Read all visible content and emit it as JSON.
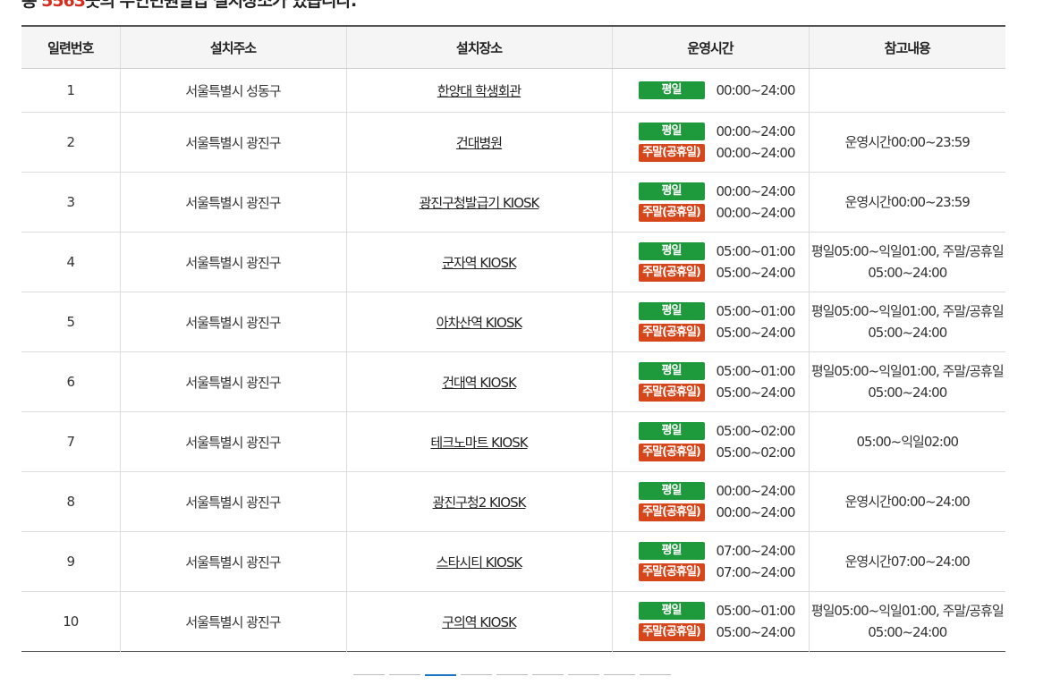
{
  "summary": {
    "prefix": "총 ",
    "count": "5563",
    "suffix": "곳의 무인민원발급 설치장소가 있습니다."
  },
  "columns": {
    "no": "일련번호",
    "address": "설치주소",
    "place": "설치장소",
    "hours": "운영시간",
    "note": "참고내용"
  },
  "labels": {
    "weekday": "평일",
    "weekend": "주말(공휴일)"
  },
  "colors": {
    "weekday_badge": "#1e9a3c",
    "weekend_badge": "#d6461a",
    "highlight_count": "#d62d20",
    "active_page": "#1a73c8"
  },
  "rows": [
    {
      "no": "1",
      "address": "서울특별시 성동구",
      "place": "한양대 학생회관",
      "weekday": "00:00~24:00",
      "weekend": "",
      "note": ""
    },
    {
      "no": "2",
      "address": "서울특별시 광진구",
      "place": "건대병원",
      "weekday": "00:00~24:00",
      "weekend": "00:00~24:00",
      "note": "운영시간00:00~23:59"
    },
    {
      "no": "3",
      "address": "서울특별시 광진구",
      "place": "광진구청발급기 KIOSK",
      "weekday": "00:00~24:00",
      "weekend": "00:00~24:00",
      "note": "운영시간00:00~23:59"
    },
    {
      "no": "4",
      "address": "서울특별시 광진구",
      "place": "군자역 KIOSK",
      "weekday": "05:00~01:00",
      "weekend": "05:00~24:00",
      "note": "평일05:00~익일01:00, 주말/공휴일 05:00~24:00"
    },
    {
      "no": "5",
      "address": "서울특별시 광진구",
      "place": "아차산역 KIOSK",
      "weekday": "05:00~01:00",
      "weekend": "05:00~24:00",
      "note": "평일05:00~익일01:00, 주말/공휴일 05:00~24:00"
    },
    {
      "no": "6",
      "address": "서울특별시 광진구",
      "place": "건대역 KIOSK",
      "weekday": "05:00~01:00",
      "weekend": "05:00~24:00",
      "note": "평일05:00~익일01:00, 주말/공휴일 05:00~24:00"
    },
    {
      "no": "7",
      "address": "서울특별시 광진구",
      "place": "테크노마트 KIOSK",
      "weekday": "05:00~02:00",
      "weekend": "05:00~02:00",
      "note": "05:00~익일02:00"
    },
    {
      "no": "8",
      "address": "서울특별시 광진구",
      "place": "광진구청2 KIOSK",
      "weekday": "00:00~24:00",
      "weekend": "00:00~24:00",
      "note": "운영시간00:00~24:00"
    },
    {
      "no": "9",
      "address": "서울특별시 광진구",
      "place": "스타시티 KIOSK",
      "weekday": "07:00~24:00",
      "weekend": "07:00~24:00",
      "note": "운영시간07:00~24:00"
    },
    {
      "no": "10",
      "address": "서울특별시 광진구",
      "place": "구의역 KIOSK",
      "weekday": "05:00~01:00",
      "weekend": "05:00~24:00",
      "note": "평일05:00~익일01:00, 주말/공휴일 05:00~24:00"
    }
  ],
  "pagination": {
    "page_count": 9,
    "active_index": 2
  }
}
